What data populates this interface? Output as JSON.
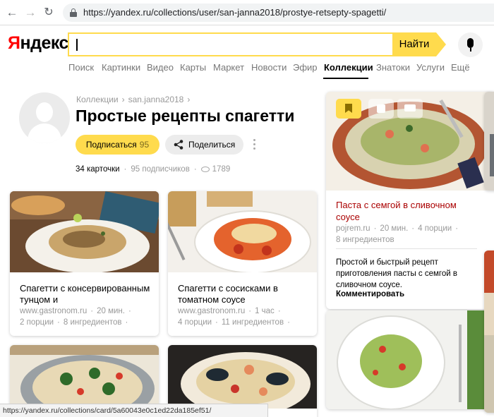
{
  "browser": {
    "back_icon": "arrow-left-icon",
    "forward_icon": "arrow-right-icon",
    "reload_icon": "reload-icon",
    "url": "https://yandex.ru/collections/user/san-janna2018/prostye-retsepty-spagetti/"
  },
  "header": {
    "logo_first": "Я",
    "logo_rest": "ндекс",
    "search_button": "Найти",
    "services": [
      "Поиск",
      "Картинки",
      "Видео",
      "Карты",
      "Маркет",
      "Новости",
      "Эфир",
      "Коллекции",
      "Знатоки",
      "Услуги",
      "Ещё"
    ],
    "active_service": "Коллекции"
  },
  "collection": {
    "breadcrumb": [
      "Коллекции",
      "san.janna2018"
    ],
    "breadcrumb_sep": "›",
    "title": "Простые рецепты спагетти",
    "subscribe_label": "Подписаться",
    "subscribe_count": "95",
    "share_label": "Поделиться",
    "cards_count": "34 карточки",
    "subscribers": "95 подписчиков",
    "views": "1789"
  },
  "cards": [
    {
      "title": "Спагетти с консервированным тунцом и",
      "source": "www.gastronom.ru",
      "time": "20 мин.",
      "portions": "2 порции",
      "ingredients": "8 ингредиентов"
    },
    {
      "title": "Спагетти с сосисками в томатном соусе",
      "source": "www.gastronom.ru",
      "time": "1 час",
      "portions": "4 порции",
      "ingredients": "11 ингредиентов"
    }
  ],
  "featured": {
    "title": "Паста с семгой в сливочном соусе",
    "source": "pojrem.ru",
    "time": "20 мин.",
    "portions": "4 порции",
    "ingredients": "8 ингредиентов",
    "description": "Простой и быстрый рецепт приготовления пасты с семгой в сливочном соусе.",
    "comment_label": "Комментировать"
  },
  "statusbar": {
    "url": "https://yandex.ru/collections/card/5a60043e0c1ed22da185ef51/"
  },
  "colors": {
    "accent_yellow": "#ffdb4d",
    "logo_red": "#ff0000",
    "featured_title": "#aa0000"
  }
}
